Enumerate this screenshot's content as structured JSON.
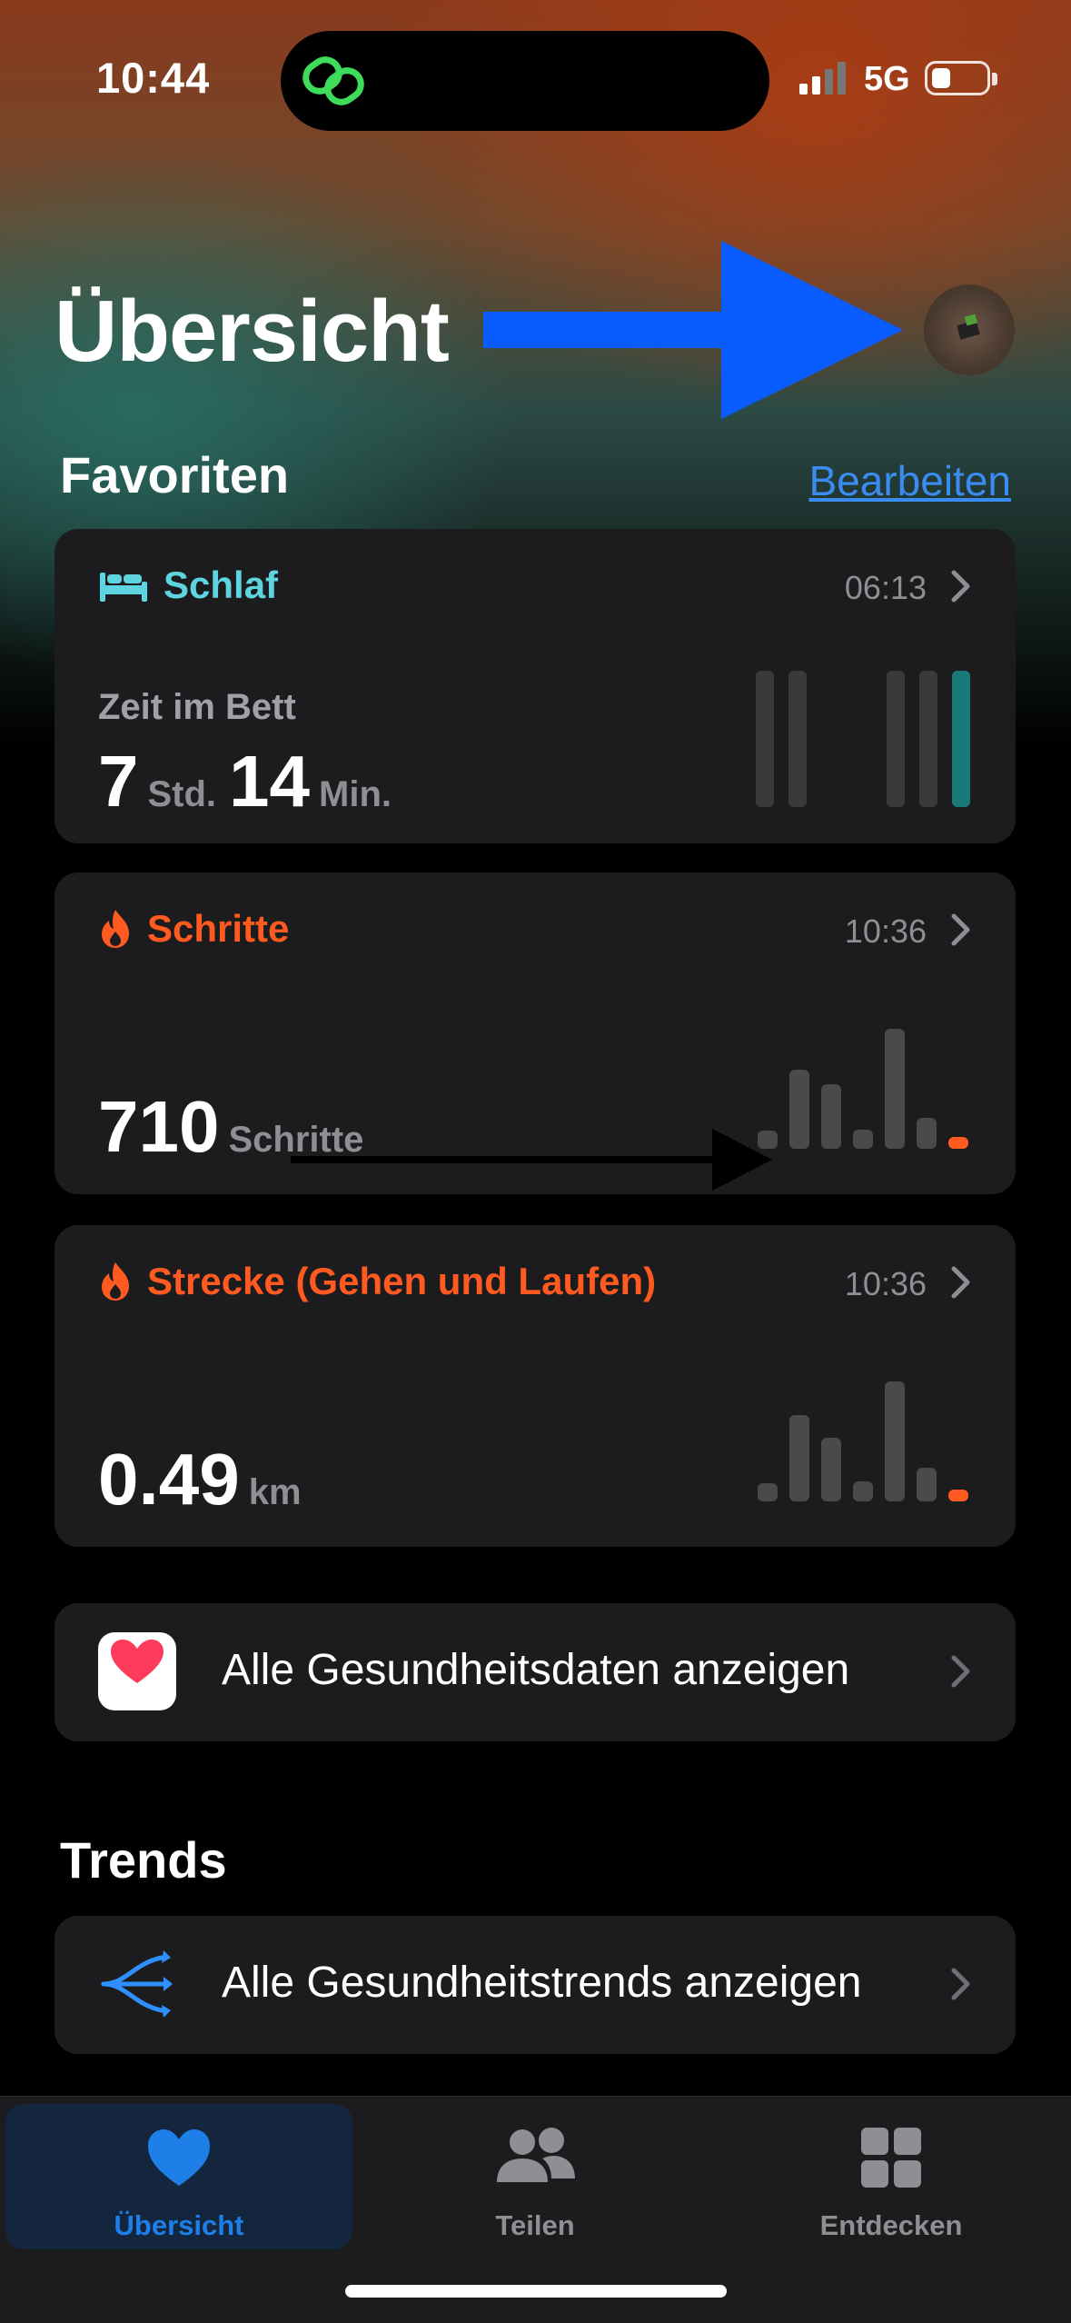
{
  "status_bar": {
    "time": "10:44",
    "network": "5G",
    "battery_level": 0.3
  },
  "header": {
    "title": "Übersicht",
    "avatar_icon": "profile-avatar"
  },
  "favorites": {
    "title": "Favoriten",
    "edit_label": "Bearbeiten",
    "cards": [
      {
        "id": "sleep",
        "title": "Schlaf",
        "color": "#5ed4e0",
        "time": "06:13",
        "subtitle": "Zeit im Bett",
        "value_parts": [
          {
            "num": "7",
            "unit": "Std."
          },
          {
            "num": "14",
            "unit": "Min."
          }
        ],
        "bars": [
          1,
          1,
          0,
          0,
          1,
          1,
          1
        ],
        "highlight_index": 6
      },
      {
        "id": "steps",
        "title": "Schritte",
        "color": "#ff5a1f",
        "time": "10:36",
        "value_parts": [
          {
            "num": "710",
            "unit": "Schritte"
          }
        ],
        "bars": [
          0.15,
          0.66,
          0.54,
          0.16,
          1.0,
          0.26,
          0.1
        ],
        "highlight_index": 6
      },
      {
        "id": "distance",
        "title": "Strecke (Gehen und Laufen)",
        "color": "#ff5a1f",
        "time": "10:36",
        "value_parts": [
          {
            "num": "0.49",
            "unit": "km"
          }
        ],
        "bars": [
          0.15,
          0.72,
          0.53,
          0.17,
          1.0,
          0.28,
          0.1
        ],
        "highlight_index": 6
      }
    ]
  },
  "all_data_row": {
    "label": "Alle Gesundheitsdaten anzeigen",
    "icon": "health-heart-icon"
  },
  "trends": {
    "title": "Trends",
    "row_label": "Alle Gesundheitstrends anzeigen",
    "icon": "trends-arrows-icon"
  },
  "tabbar": {
    "tabs": [
      {
        "label": "Übersicht",
        "icon": "heart-icon",
        "active": true
      },
      {
        "label": "Teilen",
        "icon": "people-icon",
        "active": false
      },
      {
        "label": "Entdecken",
        "icon": "grid-icon",
        "active": false
      }
    ]
  },
  "colors": {
    "accent": "#1e7fe8",
    "sleep": "#5ed4e0",
    "activity": "#ff5a1f",
    "card": "#1c1c1e",
    "annotation_arrow": "#0a5cff"
  }
}
